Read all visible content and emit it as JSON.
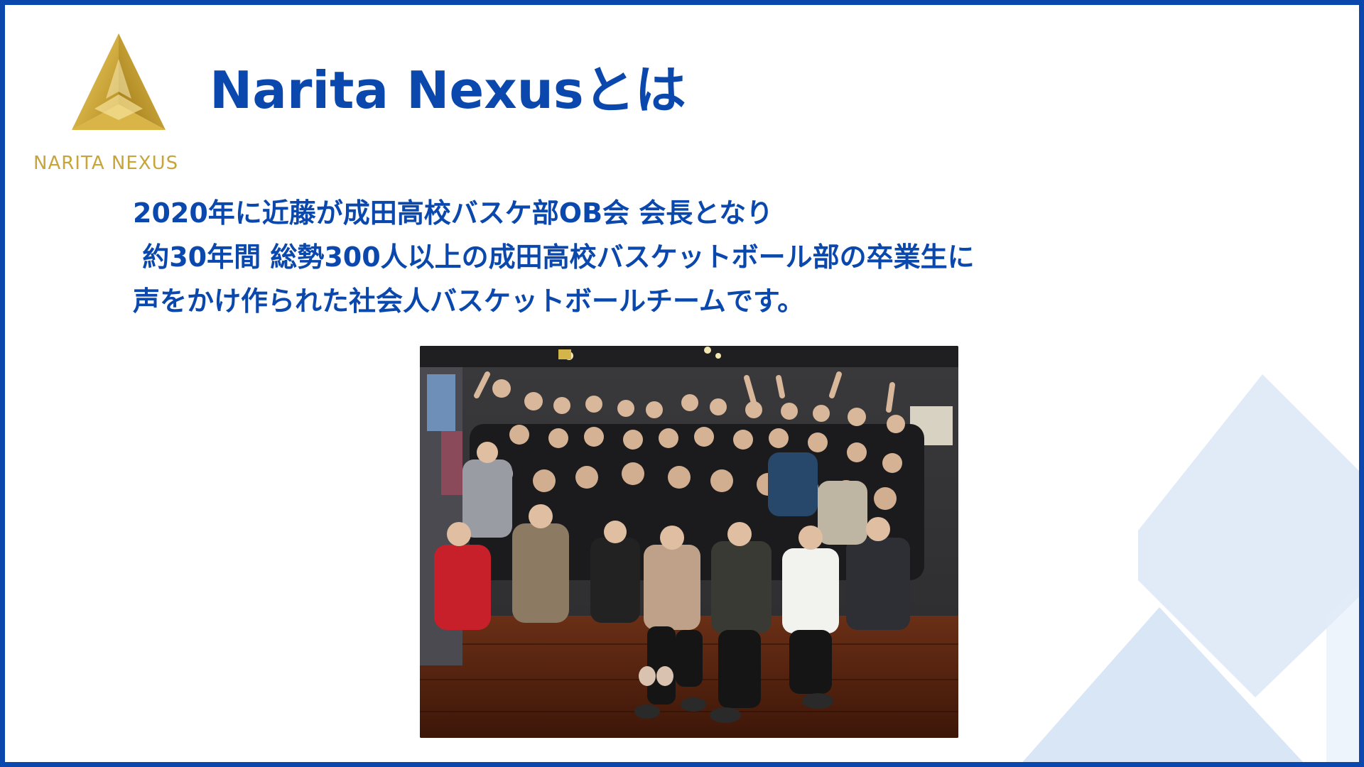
{
  "logo": {
    "text": "NARITA NEXUS",
    "icon": "gold-triangle-logo-icon",
    "color": "#c7a53a"
  },
  "title": "Narita Nexusとは",
  "description": {
    "lines": [
      "2020年に近藤が成田高校バスケ部OB会 会長となり",
      " 約30年間 総勢300人以上の成田高校バスケットボール部の卒業生に",
      "声をかけ作られた社会人バスケットボールチームです。"
    ]
  },
  "photo": {
    "subject": "team-group-photo"
  },
  "colors": {
    "brand_blue": "#0a48ad",
    "deco_light_blue": "#dce8f6",
    "gold": "#c7a53a"
  }
}
